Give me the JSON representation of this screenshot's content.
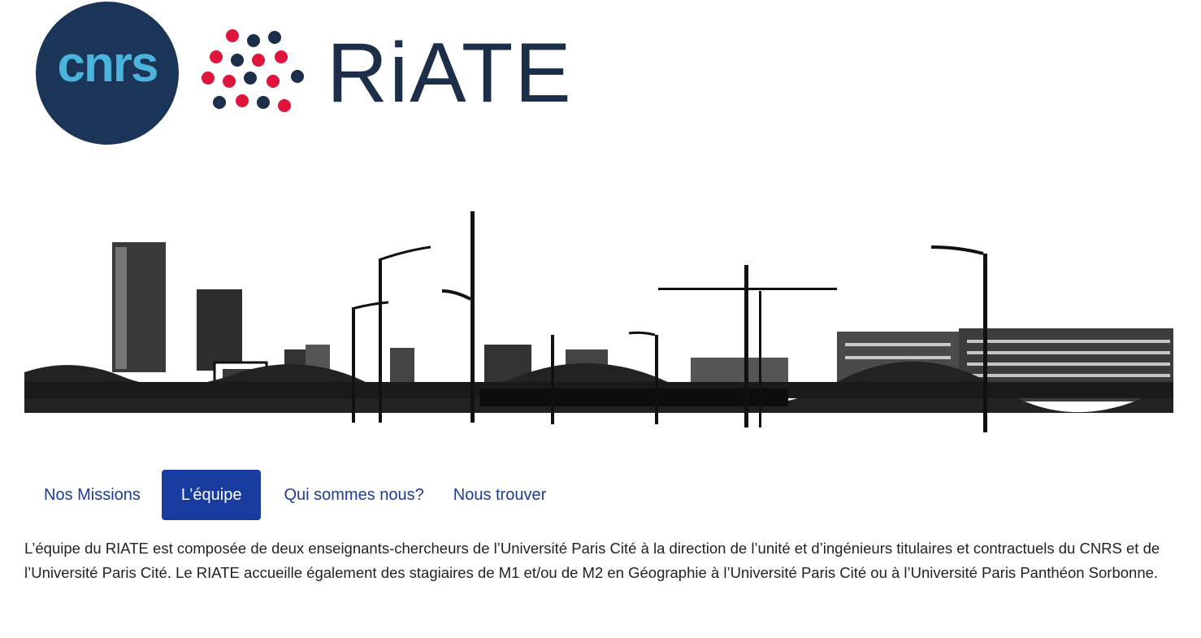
{
  "logos": {
    "cnrs_text": "cnrs",
    "riate_text": "RiATE",
    "cnrs_bg_color": "#1b3558",
    "cnrs_text_color": "#4bb4dc",
    "riate_dark_color": "#1c2e48",
    "riate_red_color": "#e0153c"
  },
  "nav": {
    "tabs": [
      {
        "label": "Nos Missions",
        "active": false
      },
      {
        "label": "L’équipe",
        "active": true
      },
      {
        "label": "Qui sommes nous?",
        "active": false
      },
      {
        "label": "Nous trouver",
        "active": false
      }
    ],
    "active_color": "#173b9e",
    "link_color": "#1e3c9a"
  },
  "content": {
    "paragraph": "L’équipe du RIATE est composée de deux enseignants-chercheurs de l’Université Paris Cité à la direction de l’unité et d’ingénieurs titulaires et contractuels du CNRS et de l’Université Paris Cité. Le RIATE accueille également des stagiaires de M1 et/ou de M2 en Géographie à l’Université Paris Cité ou à l’Université Paris Panthéon Sorbonne."
  }
}
